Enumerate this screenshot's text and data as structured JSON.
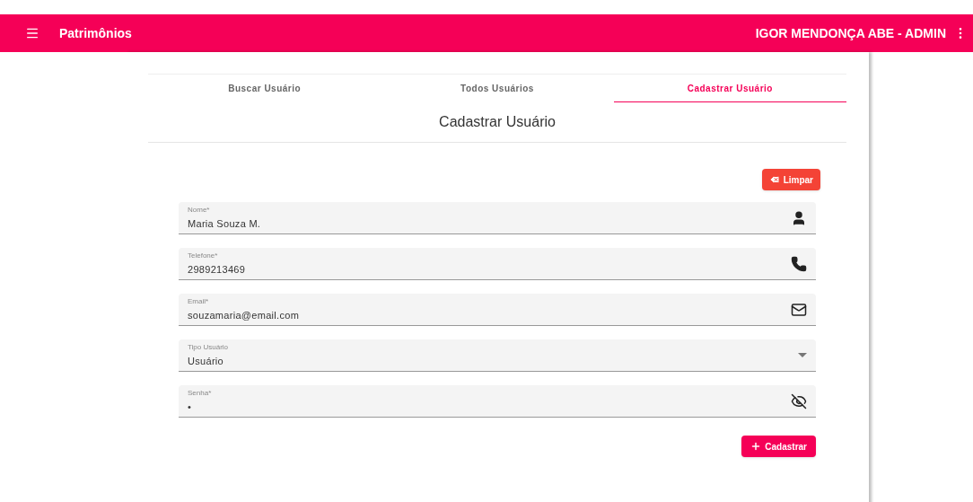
{
  "app_bar": {
    "title": "Patrimônios",
    "user": "IGOR MENDONÇA ABE - ADMIN"
  },
  "tabs": [
    {
      "label": "Buscar Usuário",
      "selected": false
    },
    {
      "label": "Todos Usuários",
      "selected": false
    },
    {
      "label": "Cadastrar Usuário",
      "selected": true
    }
  ],
  "form": {
    "heading": "Cadastrar Usuário",
    "clear_button": "Limpar",
    "submit_button": "Cadastrar",
    "fields": [
      {
        "kind": "person",
        "label": "Nome*",
        "value": "Maria Souza M."
      },
      {
        "kind": "phone",
        "label": "Telefone*",
        "value": "2989213469"
      },
      {
        "kind": "email",
        "label": "Email*",
        "value": "souzamaria@email.com"
      },
      {
        "kind": "select",
        "label": "Tipo Usuário",
        "value": "Usuário"
      },
      {
        "kind": "password",
        "label": "Senha*",
        "value": "•"
      }
    ]
  }
}
